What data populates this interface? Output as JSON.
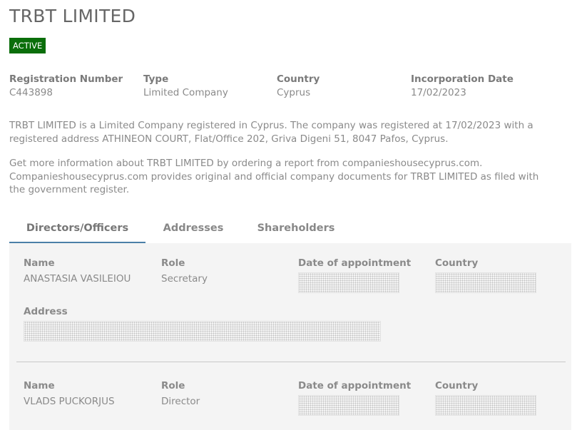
{
  "company": {
    "name": "TRBT LIMITED",
    "status": "ACTIVE",
    "status_color": "#0a6e0a"
  },
  "info": [
    {
      "label": "Registration Number",
      "value": "C443898"
    },
    {
      "label": "Type",
      "value": "Limited Company"
    },
    {
      "label": "Country",
      "value": "Cyprus"
    },
    {
      "label": "Incorporation Date",
      "value": "17/02/2023"
    }
  ],
  "description": {
    "p1": "TRBT LIMITED is a Limited Company registered in Cyprus. The company was registered at 17/02/2023 with a registered address ATHINEON COURT, Flat/Office 202, Griva Digeni 51, 8047 Pafos, Cyprus.",
    "p2": "Get more information about TRBT LIMITED by ordering a report from companieshousecyprus.com. Companieshousecyprus.com provides original and official company documents for TRBT LIMITED as filed with the government register."
  },
  "tabs": [
    {
      "label": "Directors/Officers",
      "active": true
    },
    {
      "label": "Addresses",
      "active": false
    },
    {
      "label": "Shareholders",
      "active": false
    }
  ],
  "labels": {
    "name": "Name",
    "role": "Role",
    "date_of_appointment": "Date of appointment",
    "country": "Country",
    "address": "Address"
  },
  "officers": [
    {
      "name": "ANASTASIA VASILEIOU",
      "role": "Secretary"
    },
    {
      "name": "VLADS PUCKORJUS",
      "role": "Director"
    }
  ],
  "accent_color": "#4b7fa8"
}
